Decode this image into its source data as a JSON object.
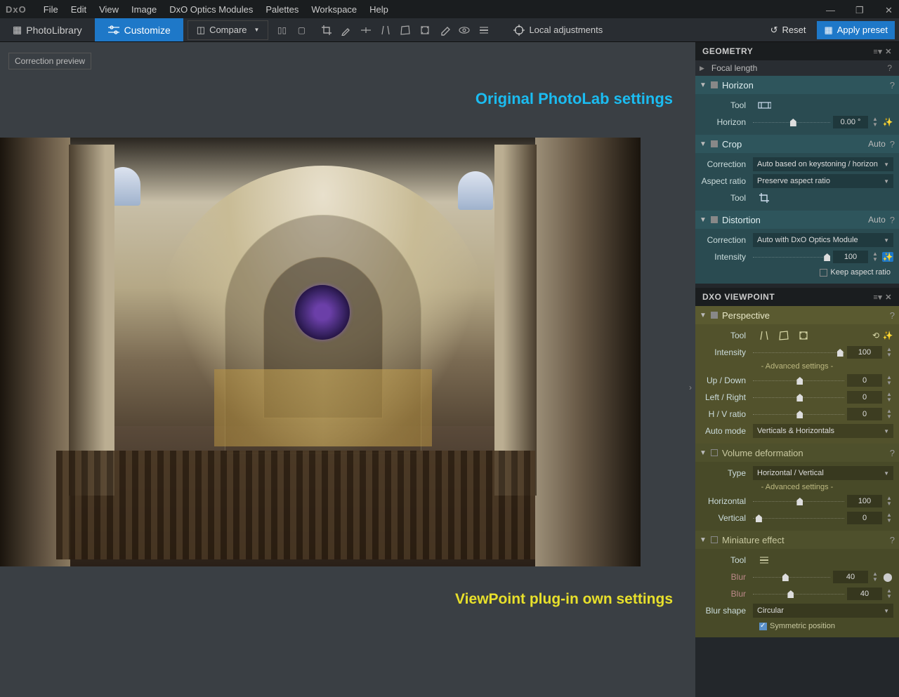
{
  "menu": {
    "items": [
      "File",
      "Edit",
      "View",
      "Image",
      "DxO Optics Modules",
      "Palettes",
      "Workspace",
      "Help"
    ]
  },
  "toolbar": {
    "photolibrary": "PhotoLibrary",
    "customize": "Customize",
    "compare": "Compare",
    "local_adjust": "Local adjustments",
    "reset": "Reset",
    "apply_preset": "Apply preset"
  },
  "correction_preview": "Correction preview",
  "labels": {
    "top": "Original PhotoLab settings",
    "bottom": "ViewPoint plug-in own settings"
  },
  "geometry": {
    "title": "GEOMETRY",
    "focal_length": "Focal length",
    "horizon": {
      "title": "Horizon",
      "tool": "Tool",
      "label": "Horizon",
      "value": "0.00 °"
    },
    "crop": {
      "title": "Crop",
      "auto": "Auto",
      "correction": "Correction",
      "correction_val": "Auto based on keystoning / horizon",
      "aspect": "Aspect ratio",
      "aspect_val": "Preserve aspect ratio",
      "tool": "Tool"
    },
    "distortion": {
      "title": "Distortion",
      "auto": "Auto",
      "correction": "Correction",
      "correction_val": "Auto with DxO Optics Module",
      "intensity": "Intensity",
      "intensity_val": "100",
      "keep_aspect": "Keep aspect ratio"
    }
  },
  "viewpoint": {
    "title": "DXO VIEWPOINT",
    "perspective": {
      "title": "Perspective",
      "tool": "Tool",
      "intensity": "Intensity",
      "intensity_val": "100",
      "advanced": "- Advanced settings -",
      "updown": "Up / Down",
      "updown_val": "0",
      "leftright": "Left / Right",
      "leftright_val": "0",
      "hv": "H / V ratio",
      "hv_val": "0",
      "automode": "Auto mode",
      "automode_val": "Verticals & Horizontals"
    },
    "volume": {
      "title": "Volume deformation",
      "type": "Type",
      "type_val": "Horizontal / Vertical",
      "advanced": "- Advanced settings -",
      "horizontal": "Horizontal",
      "horizontal_val": "100",
      "vertical": "Vertical",
      "vertical_val": "0"
    },
    "miniature": {
      "title": "Miniature effect",
      "tool": "Tool",
      "blur1": "Blur",
      "blur1_val": "40",
      "blur2": "Blur",
      "blur2_val": "40",
      "shape": "Blur shape",
      "shape_val": "Circular",
      "symmetric": "Symmetric position"
    }
  }
}
